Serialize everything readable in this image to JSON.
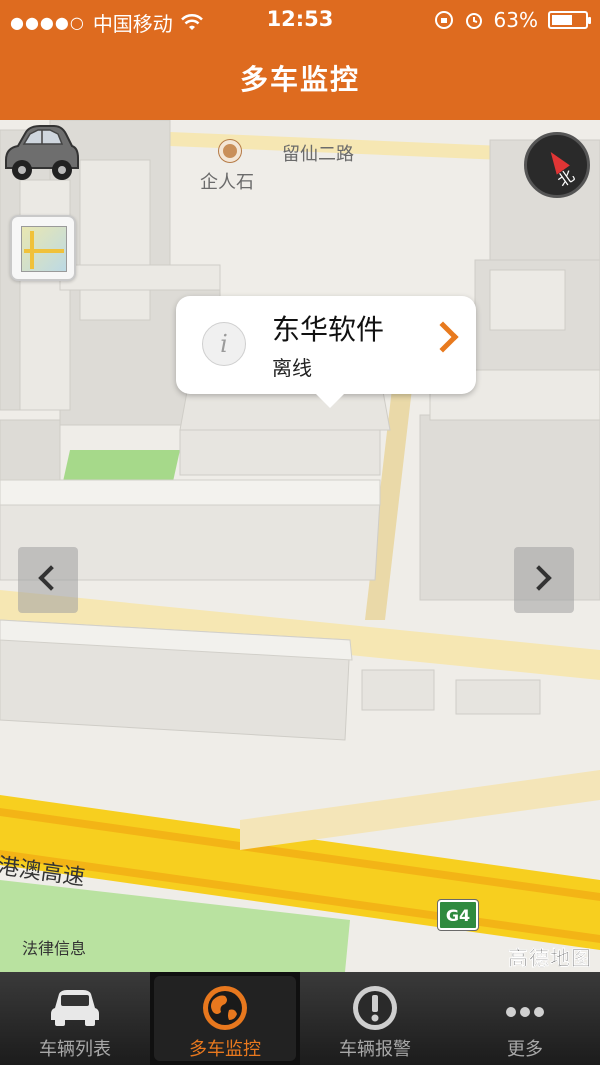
{
  "status_bar": {
    "signal_dots": "●●●●○",
    "carrier": "中国移动",
    "time": "12:53",
    "battery_percent": "63%",
    "battery_level": 0.63
  },
  "nav": {
    "title": "多车监控"
  },
  "map": {
    "road_label": "留仙二路",
    "poi_label": "企人石",
    "highway_label": "港澳高速",
    "highway_shield": "G4",
    "legal_text": "法律信息",
    "provider_logo": "高德地图",
    "compass_text": "北"
  },
  "popup": {
    "info_glyph": "i",
    "vehicle_name": "东华软件",
    "vehicle_status": "离线"
  },
  "tabs": [
    {
      "label": "车辆列表",
      "icon": "car-icon",
      "active": false
    },
    {
      "label": "多车监控",
      "icon": "globe-icon",
      "active": true
    },
    {
      "label": "车辆报警",
      "icon": "alert-icon",
      "active": false
    },
    {
      "label": "更多",
      "icon": "more-icon",
      "active": false
    }
  ],
  "colors": {
    "brand": "#de6b1f",
    "active_tab": "#e8781e"
  }
}
